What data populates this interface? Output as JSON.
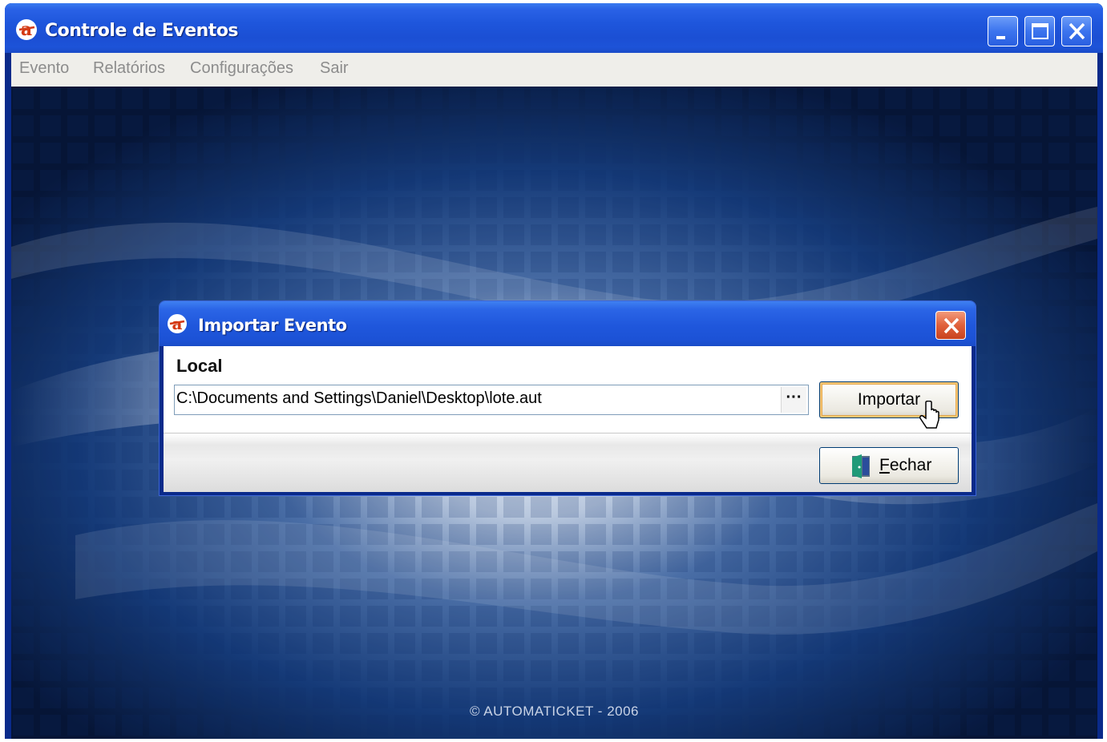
{
  "app": {
    "title": "Controle de Eventos",
    "icon": "app-logo-icon",
    "accent_color": "#d43a14"
  },
  "window_controls": {
    "minimize_icon": "minimize-icon",
    "maximize_icon": "maximize-icon",
    "close_icon": "close-icon"
  },
  "menu": {
    "items": [
      {
        "label": "Evento"
      },
      {
        "label": "Relatórios"
      },
      {
        "label": "Configurações"
      },
      {
        "label": "Sair"
      }
    ]
  },
  "footer": {
    "text": "© AUTOMATICKET - 2006"
  },
  "dialog": {
    "title": "Importar Evento",
    "icon": "app-logo-icon",
    "close_icon": "close-icon",
    "local_label": "Local",
    "path_value": "C:\\Documents and Settings\\Daniel\\Desktop\\lote.aut",
    "browse_label": "···",
    "import_button": "Importar",
    "close_button_first": "F",
    "close_button_rest": "echar",
    "close_button_icon": "door-exit-icon"
  },
  "colors": {
    "titlebar_blue": "#1f57dc",
    "dialog_close_red": "#e0603a",
    "button_focus_orange": "#f7c674"
  }
}
